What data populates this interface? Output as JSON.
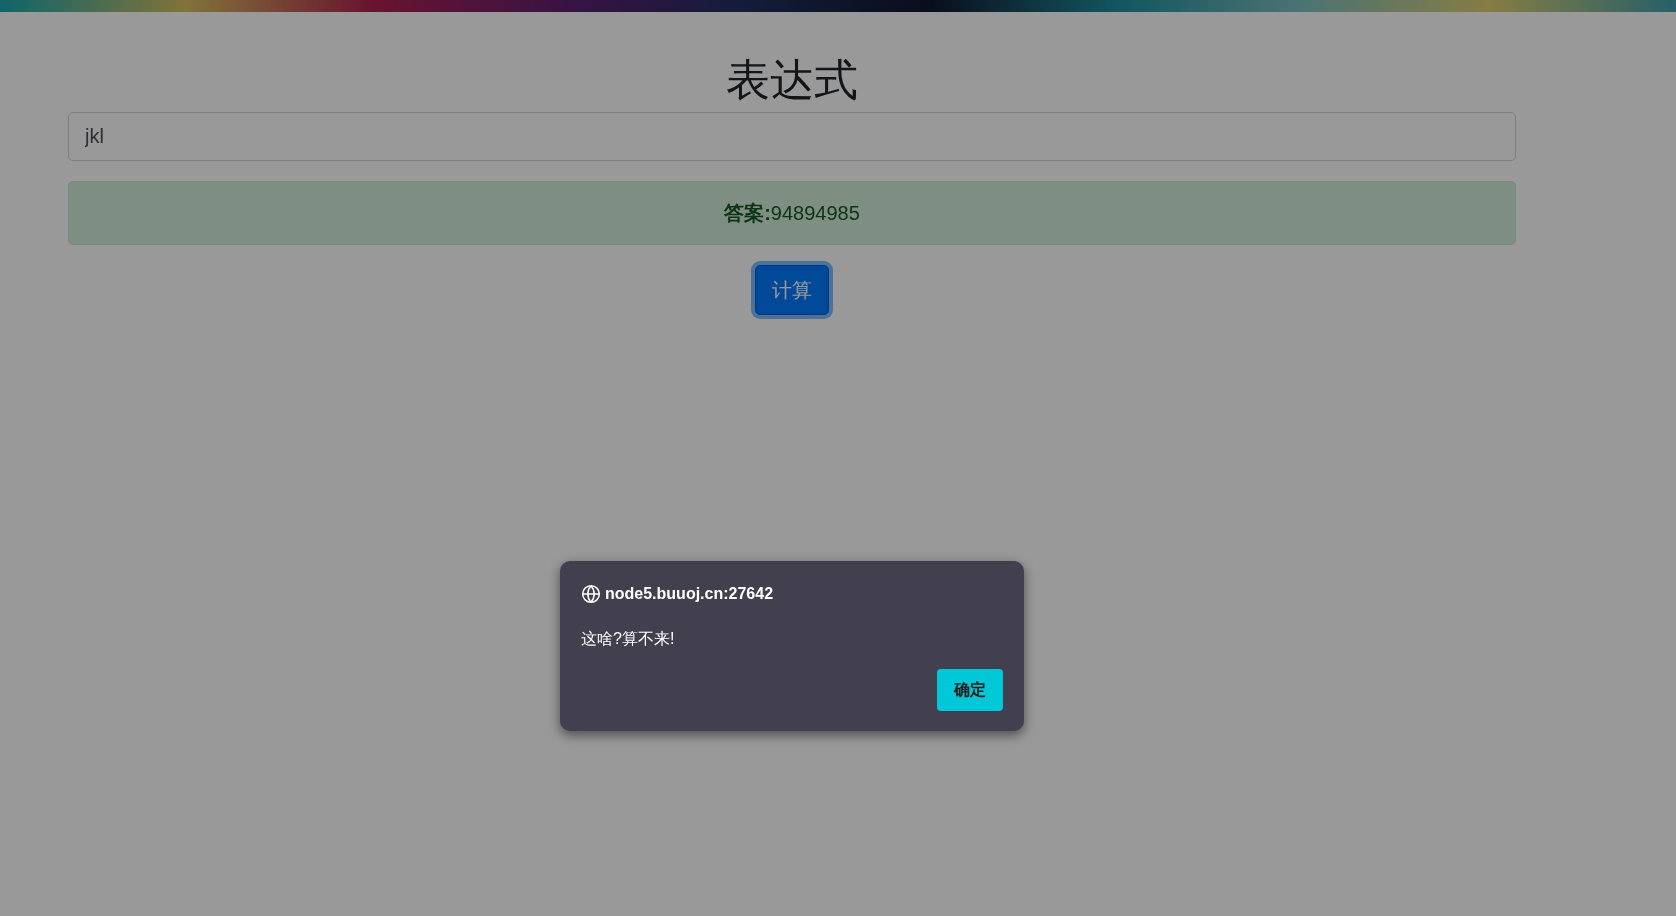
{
  "page": {
    "title": "表达式",
    "expression_field": {
      "value": "jkl"
    },
    "answer": "**答案:**94894985",
    "button": {
      "label": "计算",
      "focused": true
    }
  },
  "dialog": {
    "origin": "node5.buuoj.cn:27642",
    "message": "这啥?算不来!",
    "button": "确定"
  }
}
